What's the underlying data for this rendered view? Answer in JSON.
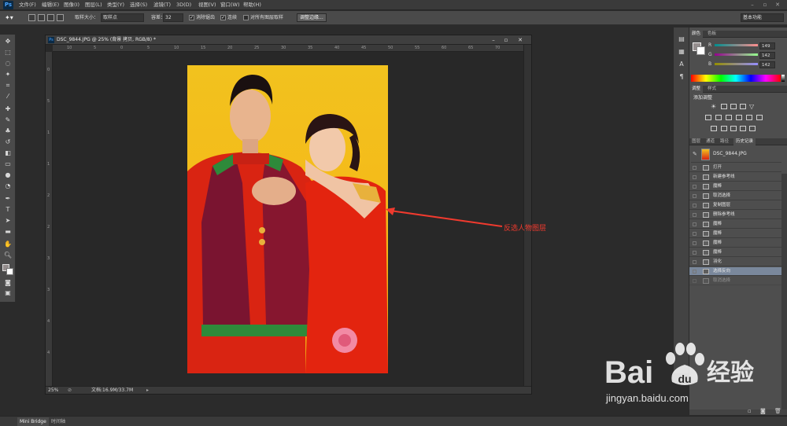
{
  "app": {
    "logo": "Ps"
  },
  "menu": [
    "文件(F)",
    "编辑(E)",
    "图像(I)",
    "图层(L)",
    "类型(Y)",
    "选择(S)",
    "滤镜(T)",
    "3D(D)",
    "视图(V)",
    "窗口(W)",
    "帮助(H)"
  ],
  "options": {
    "sample_size_label": "取样大小：",
    "sample_size_value": "取样点",
    "tolerance_label": "容差：",
    "tolerance_value": "32",
    "antialias_label": "消除锯齿",
    "contiguous_label": "连续",
    "all_layers_label": "对所有图层取样",
    "refine_edge_button": "调整边缘...",
    "workspace_value": "基本功能"
  },
  "document": {
    "icon": "Ps",
    "title": "DSC_9844.JPG @ 25% (背景 拷贝, RGB/8) *",
    "ruler_marks": [
      "10",
      "5",
      "0",
      "5",
      "10",
      "15",
      "20",
      "25",
      "30",
      "35",
      "40",
      "45",
      "50",
      "55",
      "60",
      "65",
      "70"
    ],
    "ruler_v_marks": [
      "0",
      "5",
      "1",
      "1",
      "2",
      "2",
      "3",
      "3",
      "4",
      "4"
    ],
    "zoom": "25%",
    "doc_size": "文档:16.9M/33.7M"
  },
  "annotation": {
    "text": "反选人物图层",
    "color": "#f03a2e"
  },
  "color_panel": {
    "tabs": [
      "颜色",
      "色板"
    ],
    "channels": [
      {
        "label": "R",
        "value": "149"
      },
      {
        "label": "G",
        "value": "142"
      },
      {
        "label": "B",
        "value": "142"
      }
    ]
  },
  "adjustments_panel": {
    "tabs": [
      "调整",
      "样式"
    ],
    "title": "添加调整"
  },
  "history_panel": {
    "tabs": [
      "图层",
      "通道",
      "路径",
      "历史记录"
    ],
    "snapshot": "DSC_9844.JPG",
    "items": [
      "打开",
      "新建参考线",
      "魔棒",
      "取消选择",
      "复制图层",
      "删除参考线",
      "魔棒",
      "魔棒",
      "魔棒",
      "魔棒",
      "羽化",
      "选择反向",
      "取消选择"
    ],
    "selected_index": 11
  },
  "bottom_tabs": [
    "Mini Bridge",
    "时间轴"
  ],
  "watermark": {
    "brand": "Bai",
    "brand_tail": "经验",
    "url": "jingyan.baidu.com"
  }
}
